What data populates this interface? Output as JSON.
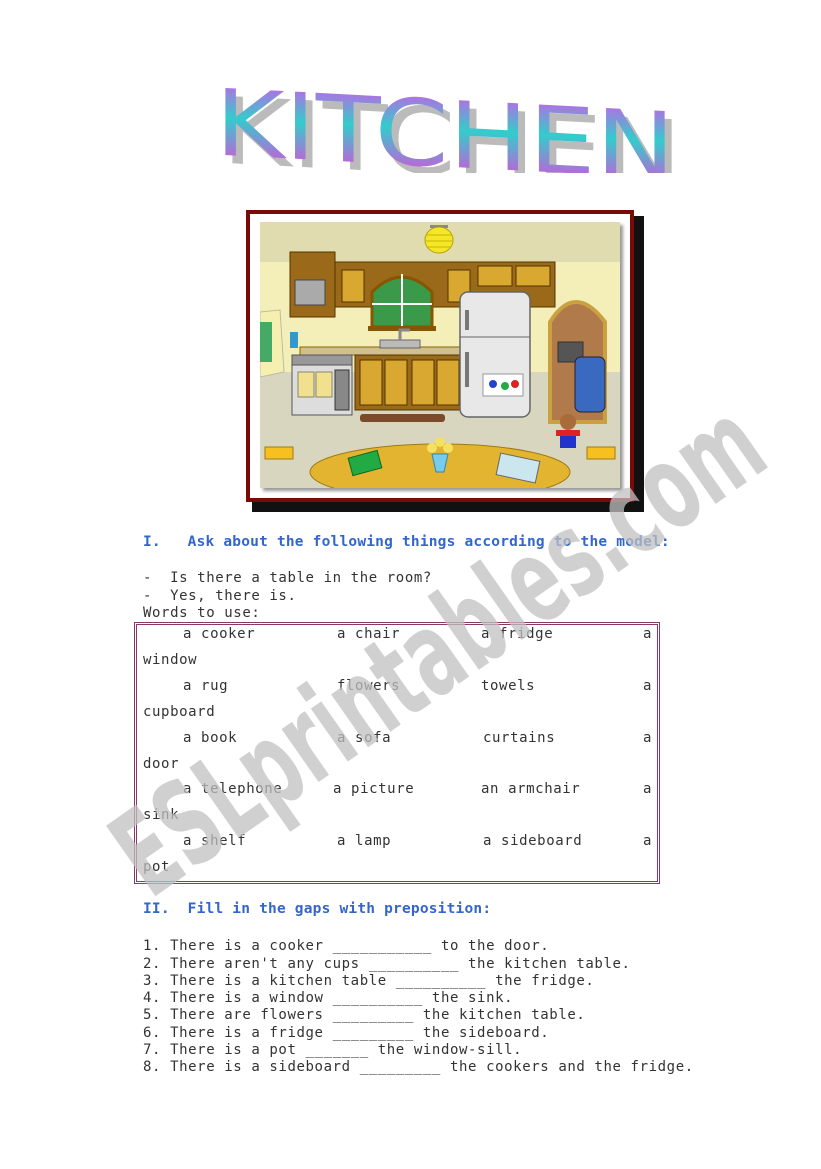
{
  "title": {
    "text": "KITCHEN",
    "gradient_colors": [
      "#ff33dd",
      "#33cccc",
      "#cc66ee"
    ]
  },
  "picture": {
    "alt": "Cartoon kitchen scene with cooker, sink, cupboards, fridge, window, lamp, table with flowers, book and picture, chairs, sofa, TV and a child",
    "frame_color": "#7a0a0a"
  },
  "section1": {
    "heading": "I.   Ask about the following things according to the model:",
    "model_question": "-  Is there a table in the room?",
    "model_answer": "-  Yes, there is.",
    "words_label": "Words to use:",
    "word_rows": [
      {
        "items": [
          "a cooker",
          "a chair",
          "a fridge",
          "a"
        ],
        "wrap": "window"
      },
      {
        "items": [
          "a rug",
          "flowers",
          "towels",
          "a"
        ],
        "wrap": "cupboard"
      },
      {
        "items": [
          "a book",
          "a sofa",
          "curtains",
          "a"
        ],
        "wrap": "door"
      },
      {
        "items": [
          "a telephone",
          "a picture",
          "an armchair",
          "a"
        ],
        "wrap": "sink"
      },
      {
        "items": [
          "a shelf",
          "a lamp",
          "a sideboard",
          "a"
        ],
        "wrap": "pot"
      }
    ],
    "box_border_color": "#8a3a6a"
  },
  "section2": {
    "heading": "II.  Fill in the gaps with preposition:",
    "sentences": [
      "1. There is a cooker ___________ to the door.",
      "2. There aren't any cups __________ the kitchen table.",
      "3. There is a kitchen table __________ the fridge.",
      "4. There is a window __________ the sink.",
      "5. There are flowers _________ the kitchen table.",
      "6. There is a fridge _________ the sideboard.",
      "7. There is a pot _______ the window-sill.",
      "8. There is a sideboard _________ the cookers and the fridge."
    ]
  },
  "heading_color": "#3366cc",
  "watermark": {
    "text": "ESLprintables.com",
    "color": "#c8c8c8"
  }
}
